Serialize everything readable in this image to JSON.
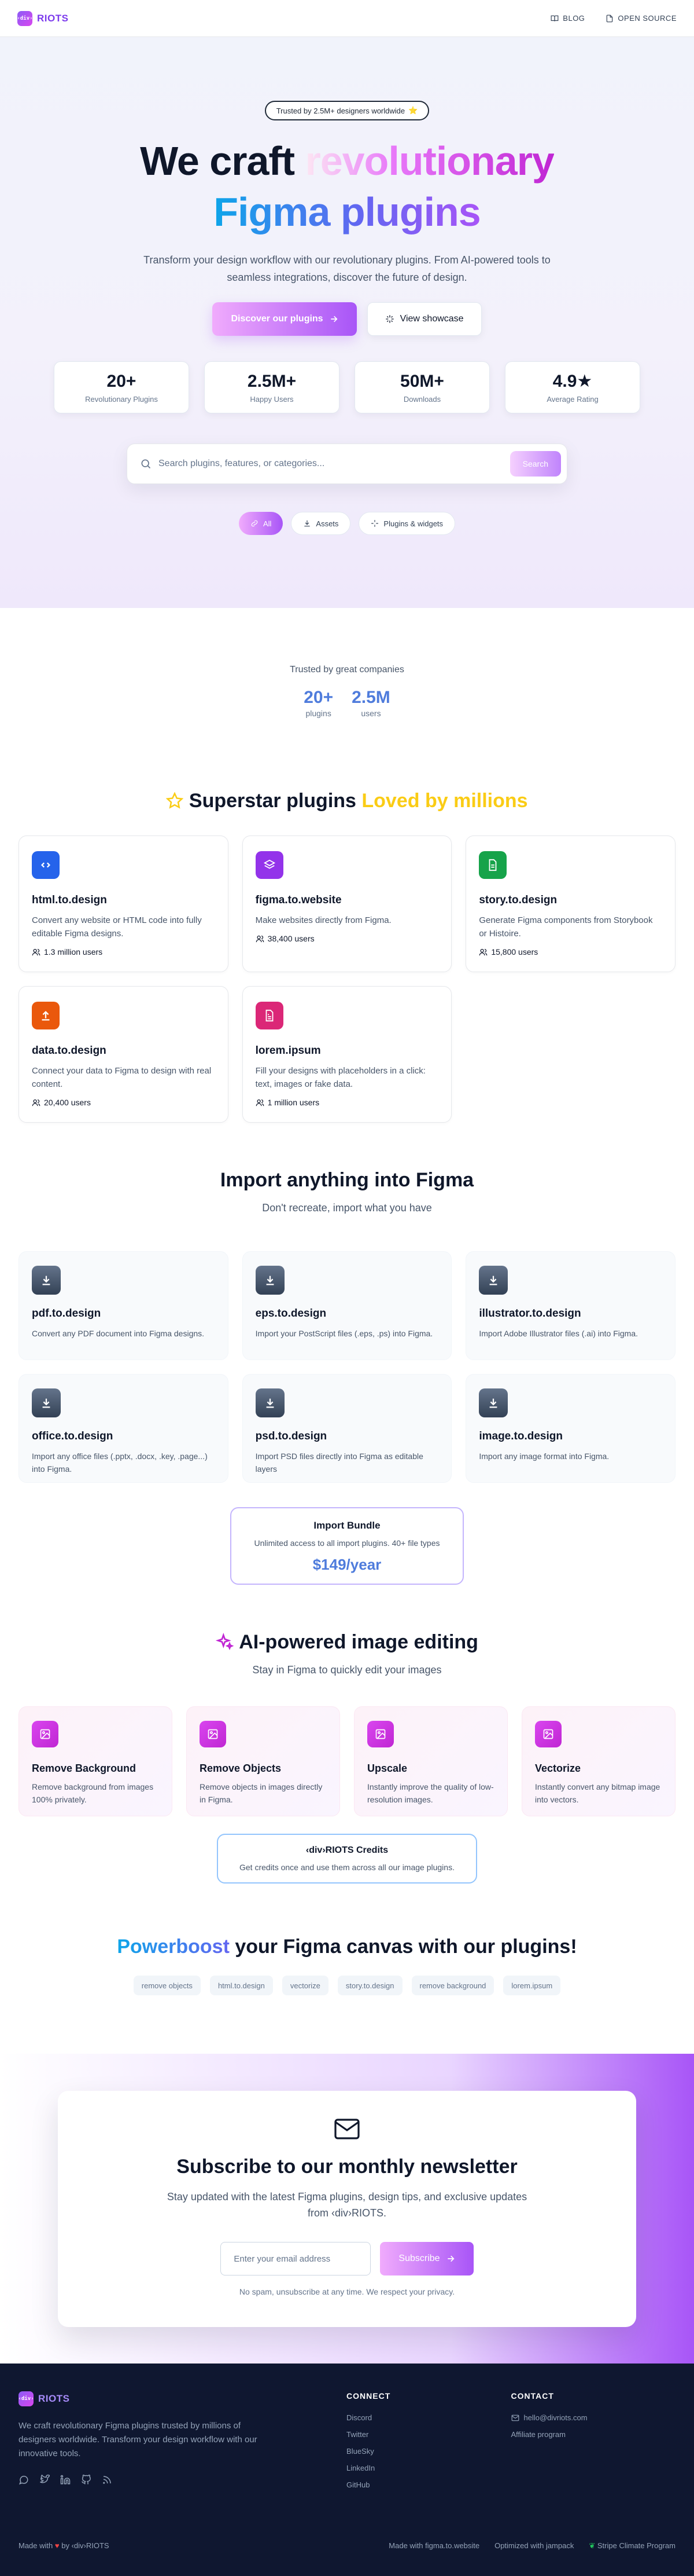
{
  "nav": {
    "brand_mark": "‹div›",
    "brand": "RIOTS",
    "links": [
      {
        "label": "BLOG",
        "icon": "book-icon"
      },
      {
        "label": "OPEN SOURCE",
        "icon": "document-icon"
      }
    ]
  },
  "hero": {
    "trust_badge": "Trusted by 2.5M+ designers worldwide",
    "trust_emoji": "⭐",
    "title_1": "We craft ",
    "title_highlight": "revolutionary",
    "title_2": "Figma plugins",
    "subtitle": "Transform your design workflow with our revolutionary plugins. From AI-powered tools to seamless integrations, discover the future of design.",
    "primary_cta": "Discover our plugins",
    "secondary_cta": "View showcase",
    "stats": [
      {
        "value": "20+",
        "label": "Revolutionary Plugins"
      },
      {
        "value": "2.5M+",
        "label": "Happy Users"
      },
      {
        "value": "50M+",
        "label": "Downloads"
      },
      {
        "value": "4.9★",
        "label": "Average Rating"
      }
    ],
    "search_placeholder": "Search plugins, features, or categories...",
    "search_button": "Search",
    "chips": [
      {
        "label": "All",
        "active": true
      },
      {
        "label": "Assets",
        "active": false
      },
      {
        "label": "Plugins & widgets",
        "active": false
      }
    ]
  },
  "companies": {
    "label": "Trusted by great companies",
    "stats": [
      {
        "value": "20+",
        "label": "plugins"
      },
      {
        "value": "2.5M",
        "label": "users"
      }
    ]
  },
  "superstar": {
    "title_1": "Superstar plugins ",
    "title_highlight": "Loved by millions",
    "plugins": [
      {
        "name": "html.to.design",
        "desc": "Convert any website or HTML code into fully editable Figma designs.",
        "users": "1.3 million users",
        "color": "#2563eb",
        "icon": "code-icon"
      },
      {
        "name": "figma.to.website",
        "desc": "Make websites directly from Figma.",
        "users": "38,400 users",
        "color": "#9333ea",
        "icon": "layers-icon"
      },
      {
        "name": "story.to.design",
        "desc": "Generate Figma components from Storybook or Histoire.",
        "users": "15,800 users",
        "color": "#16a34a",
        "icon": "file-icon"
      },
      {
        "name": "data.to.design",
        "desc": "Connect your data to Figma to design with real content.",
        "users": "20,400 users",
        "color": "#ea580c",
        "icon": "upload-icon"
      },
      {
        "name": "lorem.ipsum",
        "desc": "Fill your designs with placeholders in a click: text, images or fake data.",
        "users": "1 million users",
        "color": "#db2777",
        "icon": "text-file-icon"
      }
    ]
  },
  "import": {
    "title": "Import anything into Figma",
    "subtitle": "Don't recreate, import what you have",
    "items": [
      {
        "name": "pdf.to.design",
        "desc": "Convert any PDF document into Figma designs."
      },
      {
        "name": "eps.to.design",
        "desc": "Import your PostScript files (.eps, .ps) into Figma."
      },
      {
        "name": "illustrator.to.design",
        "desc": "Import Adobe Illustrator files (.ai) into Figma."
      },
      {
        "name": "office.to.design",
        "desc": "Import any office files (.pptx, .docx, .key, .page...) into Figma."
      },
      {
        "name": "psd.to.design",
        "desc": "Import PSD files directly into Figma as editable layers"
      },
      {
        "name": "image.to.design",
        "desc": "Import any image format into Figma."
      }
    ],
    "bundle": {
      "title": "Import Bundle",
      "desc": "Unlimited access to all import plugins. 40+ file types",
      "price": "$149/year"
    }
  },
  "ai": {
    "title": "AI-powered image editing",
    "subtitle": "Stay in Figma to quickly edit your images",
    "items": [
      {
        "name": "Remove Background",
        "desc": "Remove background from images 100% privately."
      },
      {
        "name": "Remove Objects",
        "desc": "Remove objects in images directly in Figma."
      },
      {
        "name": "Upscale",
        "desc": "Instantly improve the quality of low-resolution images."
      },
      {
        "name": "Vectorize",
        "desc": "Instantly convert any bitmap image into vectors."
      }
    ],
    "credits": {
      "title": "‹div›RIOTS Credits",
      "desc": "Get credits once and use them across all our image plugins."
    }
  },
  "powerboost": {
    "title_highlight": "Powerboost",
    "title_rest": " your Figma canvas with our plugins!",
    "tags": [
      "remove objects",
      "html.to.design",
      "vectorize",
      "story.to.design",
      "remove background",
      "lorem.ipsum"
    ]
  },
  "newsletter": {
    "title": "Subscribe to our monthly newsletter",
    "subtitle": "Stay updated with the latest Figma plugins, design tips, and exclusive updates from ‹div›RIOTS.",
    "email_placeholder": "Enter your email address",
    "button": "Subscribe",
    "note": "No spam, unsubscribe at any time. We respect your privacy."
  },
  "footer": {
    "brand_mark": "‹div›",
    "brand": "RIOTS",
    "desc": "We craft revolutionary Figma plugins trusted by millions of designers worldwide. Transform your design workflow with our innovative tools.",
    "connect_title": "CONNECT",
    "connect_links": [
      "Discord",
      "Twitter",
      "BlueSky",
      "LinkedIn",
      "GitHub"
    ],
    "contact_title": "CONTACT",
    "contact_email": "hello@divriots.com",
    "contact_affiliate": "Affiliate program",
    "made_with_1": "Made with",
    "made_with_2": "by ‹div›RIOTS",
    "bottom_links": [
      "Made with figma.to.website",
      "Optimized with jampack",
      "Stripe Climate Program"
    ]
  }
}
